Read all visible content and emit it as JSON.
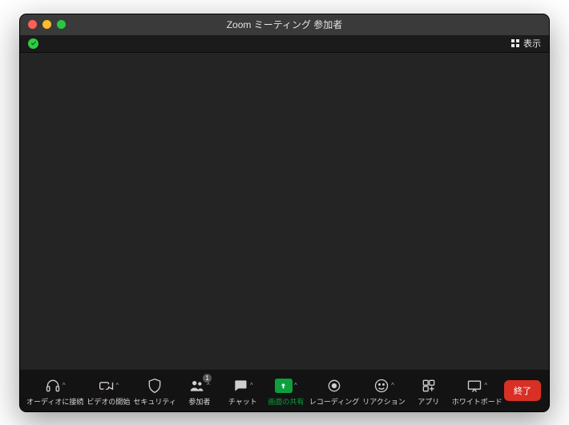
{
  "window": {
    "title": "Zoom ミーティング 参加者"
  },
  "status": {
    "view_label": "表示"
  },
  "toolbar": {
    "audio": {
      "label": "オーディオに接続",
      "caret": true
    },
    "video": {
      "label": "ビデオの開始",
      "caret": true,
      "disabled": true
    },
    "security": {
      "label": "セキュリティ",
      "caret": false
    },
    "participants": {
      "label": "参加者",
      "caret": true,
      "count": "1"
    },
    "chat": {
      "label": "チャット",
      "caret": true
    },
    "share": {
      "label": "画面の共有",
      "caret": true
    },
    "record": {
      "label": "レコーディング"
    },
    "reactions": {
      "label": "リアクション",
      "caret": true
    },
    "apps": {
      "label": "アプリ"
    },
    "whiteboard": {
      "label": "ホワイトボード",
      "caret": true
    },
    "end": {
      "label": "終了"
    }
  }
}
